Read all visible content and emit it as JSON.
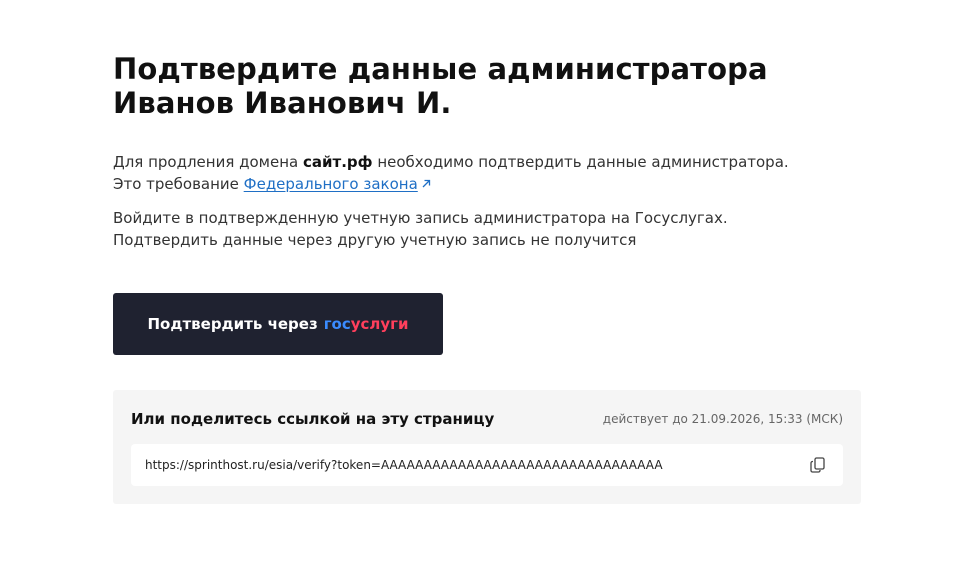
{
  "header": {
    "title_line1": "Подтвердите данные администратора",
    "title_line2": "Иванов Иванович И."
  },
  "intro": {
    "line1_prefix": "Для продления домена ",
    "domain": "сайт.рф",
    "line1_suffix": " необходимо подтвердить данные администратора.",
    "line2_prefix": "Это требование ",
    "law_link": "Федерального закона"
  },
  "login_note": {
    "line1": "Войдите в подтвержденную учетную запись администратора на Госуслугах.",
    "line2": "Подтвердить данные через другую учетную запись не получится"
  },
  "confirm_button": {
    "label": "Подтвердить через",
    "brand_part1": "гос",
    "brand_part2": "услуги"
  },
  "share": {
    "title": "Или поделитесь ссылкой на эту страницу",
    "valid_until": "действует до 21.09.2026, 15:33 (МСК)",
    "url": "https://sprinthost.ru/esia/verify?token=AAAAAAAAAAAAAAAAAAAAAAAAAAAAAAAAA"
  },
  "icons": {
    "external_link": "external-link-icon",
    "copy": "copy-icon"
  },
  "colors": {
    "button_bg": "#1f2230",
    "link": "#1f6fc5",
    "brand_blue": "#3b8cff",
    "brand_red": "#ff3f5c",
    "share_bg": "#f5f5f5"
  }
}
